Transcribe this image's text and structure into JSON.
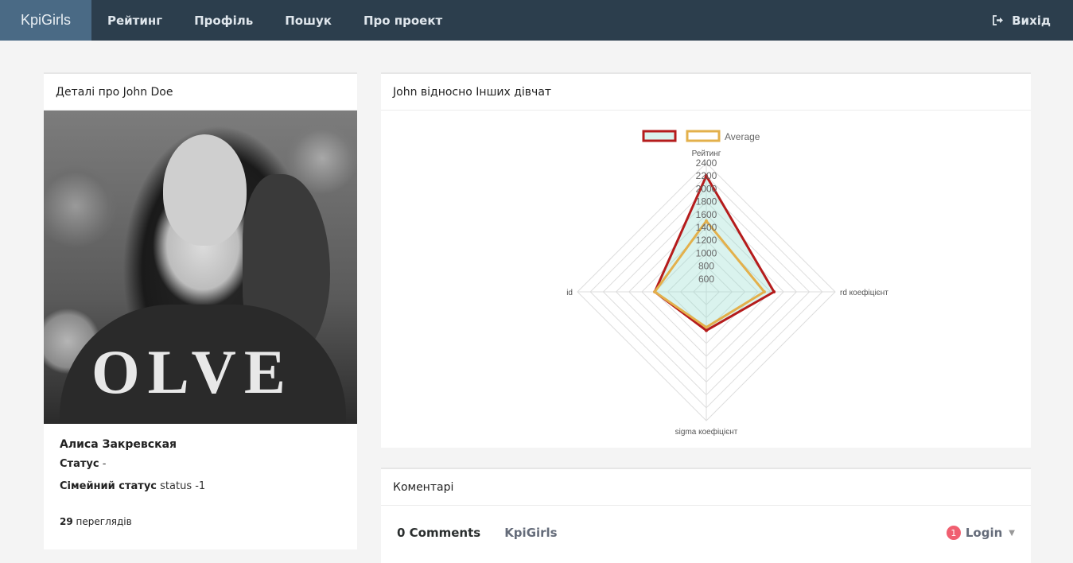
{
  "nav": {
    "brand": "KpiGirls",
    "links": [
      "Рейтинг",
      "Профіль",
      "Пошук",
      "Про проект"
    ],
    "logout": "Вихід"
  },
  "profile": {
    "heading": "Деталі про John Doe",
    "name": "Алиса Закревская",
    "status_label": "Статус",
    "status_value": "-",
    "family_label": "Сімейний статус",
    "family_value": "status -1",
    "views_count": "29",
    "views_label": "переглядів"
  },
  "chart_panel": {
    "heading": "John відносно Інших дівчат"
  },
  "chart_data": {
    "type": "radar",
    "axes": [
      "Рейтинг",
      "rd коефіцієнт",
      "sigma коефіцієнт",
      "id"
    ],
    "r_min": 400,
    "r_max": 2400,
    "tick_step": 200,
    "tick_labels": [
      "600",
      "800",
      "1000",
      "1200",
      "1400",
      "1600",
      "1800",
      "2000",
      "2200",
      "2400"
    ],
    "series": [
      {
        "name": "",
        "values": [
          2200,
          1450,
          1000,
          1200
        ],
        "color": "#b51c1c",
        "fill": "rgba(150,220,205,0.35)"
      },
      {
        "name": "Average",
        "values": [
          1500,
          1300,
          950,
          1200
        ],
        "color": "#e3b04b",
        "fill": "rgba(0,0,0,0)"
      }
    ]
  },
  "comments": {
    "heading": "Коментарі",
    "count_label": "0 Comments",
    "site": "KpiGirls",
    "notif": "1",
    "login": "Login"
  },
  "colors": {
    "nav_bg": "#2c3e4d",
    "brand_bg": "#4a6a85"
  }
}
